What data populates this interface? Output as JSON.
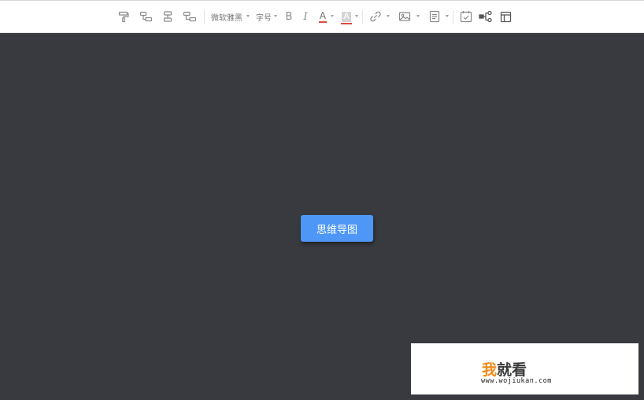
{
  "toolbar": {
    "font_family": "微软雅黑",
    "font_size": "字号",
    "bold_label": "B",
    "italic_label": "I",
    "font_color_label": "A",
    "highlight_label": "A",
    "font_color_bar": "#e04a3f",
    "highlight_bar": "#e04a3f",
    "icons": [
      "format-painter-icon",
      "clear-format-icon",
      "sibling-node-icon",
      "child-node-icon",
      "link-icon",
      "image-icon",
      "note-icon",
      "task-icon",
      "mindmap-structure-icon",
      "layout-icon"
    ]
  },
  "canvas": {
    "background": "#393a40",
    "root_node_label": "思维导图",
    "root_node_color": "#4e97f7"
  },
  "watermark": {
    "char_1": "我",
    "char_1_color": "#f08a1c",
    "chars_rest": "就看",
    "chars_rest_color": "#3a3a3a",
    "url": "www.wojiukan.com"
  }
}
